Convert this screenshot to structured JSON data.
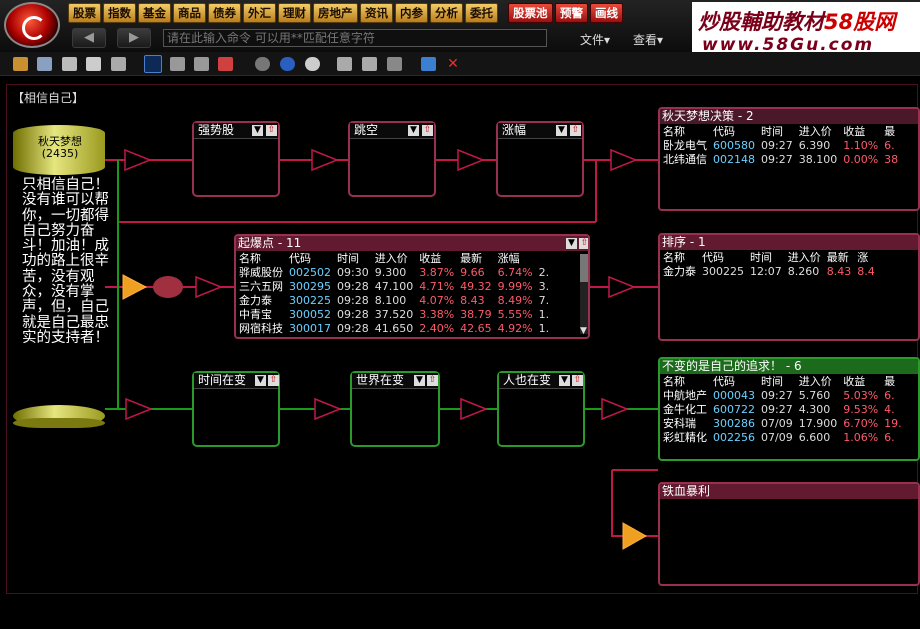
{
  "menu_buttons": [
    "股票",
    "指数",
    "基金",
    "商品",
    "债券",
    "外汇",
    "理财",
    "房地产",
    "资讯",
    "内参",
    "分析",
    "委托"
  ],
  "red_buttons": [
    "股票池",
    "预警",
    "画线"
  ],
  "brand": {
    "line1_prefix": "炒股輔助教材",
    "line1_em": "58股网",
    "line2": "www.58Gu.com"
  },
  "command_placeholder": "请在此输入命令  可以用**匹配任意字符",
  "menus": {
    "file": "文件▾",
    "view": "查看▾"
  },
  "canvas_title": "【相信自己】",
  "cylinder": {
    "name": "秋天梦想",
    "count": "(2435)",
    "note": "只相信自己！没有谁可以帮你，一切都得自己努力奋斗！加油！成功的路上很辛苦，没有观众，没有掌声，但，自己就是自己最忠实的支持者！"
  },
  "nodes": {
    "qiangshi": "强势股",
    "tiaokong": "跳空",
    "zhangfu": "涨幅",
    "shijian": "时间在变",
    "shijie": "世界在变",
    "renye": "人也在变"
  },
  "panels": {
    "qiutian": {
      "title": "秋天梦想决策 - 2",
      "headers": [
        "名称",
        "代码",
        "时间",
        "进入价",
        "收益",
        "最"
      ],
      "rows": [
        {
          "name": "卧龙电气",
          "code": "600580",
          "time": "09:27",
          "price": "6.390",
          "gain": "1.10%",
          "last": "6."
        },
        {
          "name": "北纬通信",
          "code": "002148",
          "time": "09:27",
          "price": "38.100",
          "gain": "0.00%",
          "last": "38"
        }
      ]
    },
    "qibao": {
      "title": "起爆点 - 11",
      "headers": [
        "名称",
        "代码",
        "时间",
        "进入价",
        "收益",
        "最新",
        "涨幅",
        ""
      ],
      "rows": [
        {
          "name": "骅威股份",
          "code": "002502",
          "time": "09:30",
          "price": "9.300",
          "gain": "3.87%",
          "last": "9.66",
          "chg": "6.74%",
          "x": "2."
        },
        {
          "name": "三六五网",
          "code": "300295",
          "time": "09:28",
          "price": "47.100",
          "gain": "4.71%",
          "last": "49.32",
          "chg": "9.99%",
          "x": "3."
        },
        {
          "name": "金力泰",
          "code": "300225",
          "time": "09:28",
          "price": "8.100",
          "gain": "4.07%",
          "last": "8.43",
          "chg": "8.49%",
          "x": "7."
        },
        {
          "name": "中青宝",
          "code": "300052",
          "time": "09:28",
          "price": "37.520",
          "gain": "3.38%",
          "last": "38.79",
          "chg": "5.55%",
          "x": "1."
        },
        {
          "name": "网宿科技",
          "code": "300017",
          "time": "09:28",
          "price": "41.650",
          "gain": "2.40%",
          "last": "42.65",
          "chg": "4.92%",
          "x": "1."
        }
      ]
    },
    "paixu": {
      "title": "排序 - 1",
      "headers": [
        "名称",
        "代码",
        "时间",
        "进入价",
        "最新",
        "涨"
      ],
      "rows": [
        {
          "name": "金力泰",
          "code": "300225",
          "time": "12:07",
          "price": "8.260",
          "last": "8.43",
          "chg": "8.4"
        }
      ]
    },
    "zhuiqiu": {
      "title": "不变的是自己的追求！ - 6",
      "headers": [
        "名称",
        "代码",
        "时间",
        "进入价",
        "收益",
        "最"
      ],
      "rows": [
        {
          "name": "中航地产",
          "code": "000043",
          "time": "09:27",
          "price": "5.760",
          "gain": "5.03%",
          "last": "6."
        },
        {
          "name": "金牛化工",
          "code": "600722",
          "time": "09:27",
          "price": "4.300",
          "gain": "9.53%",
          "last": "4."
        },
        {
          "name": "安科瑞",
          "code": "300286",
          "time": "07/09",
          "price": "17.900",
          "gain": "6.70%",
          "last": "19."
        },
        {
          "name": "彩虹精化",
          "code": "002256",
          "time": "07/09",
          "price": "6.600",
          "gain": "1.06%",
          "last": "6."
        }
      ]
    },
    "tiexue": {
      "title": "铁血暴利"
    }
  }
}
